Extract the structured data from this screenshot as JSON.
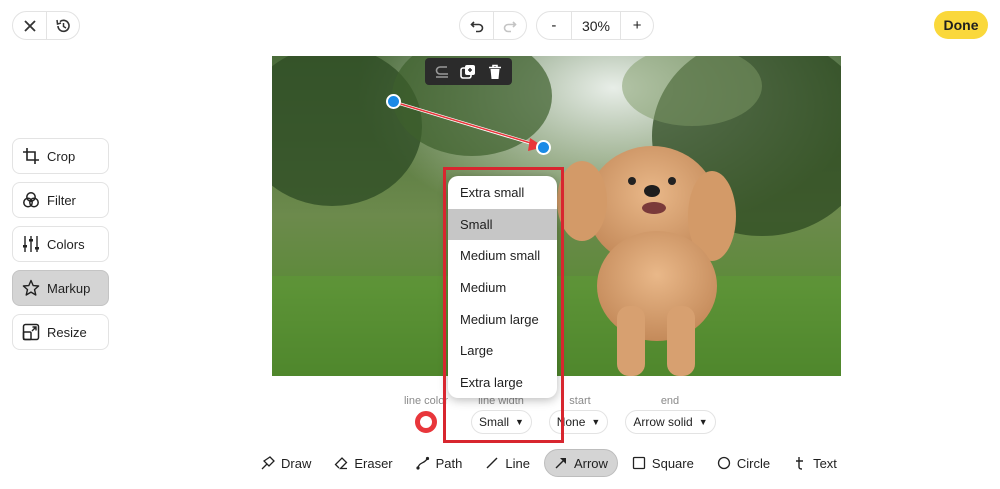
{
  "header": {
    "close_icon": "close-icon",
    "history_icon": "history-icon",
    "undo_icon": "undo-icon",
    "redo_icon": "redo-icon",
    "zoom_out_label": "-",
    "zoom_level": "30%",
    "zoom_in_label": "+",
    "done_label": "Done"
  },
  "sidebar": {
    "items": [
      {
        "label": "Crop",
        "icon": "crop-icon"
      },
      {
        "label": "Filter",
        "icon": "filter-icon"
      },
      {
        "label": "Colors",
        "icon": "sliders-icon"
      },
      {
        "label": "Markup",
        "icon": "star-icon",
        "active": true
      },
      {
        "label": "Resize",
        "icon": "resize-icon"
      }
    ]
  },
  "floating_toolbar": {
    "icons": [
      "reply-icon",
      "duplicate-icon",
      "trash-icon"
    ]
  },
  "options": {
    "line_color_label": "line color",
    "line_width_label": "line width",
    "line_width_value": "Small",
    "start_label": "start",
    "start_value": "None",
    "end_label": "end",
    "end_value": "Arrow solid",
    "line_color": "#e8363b"
  },
  "dropdown": {
    "items": [
      "Extra small",
      "Small",
      "Medium small",
      "Medium",
      "Medium large",
      "Large",
      "Extra large"
    ],
    "selected": "Small"
  },
  "markup_tools": [
    {
      "label": "Draw",
      "icon": "draw-icon"
    },
    {
      "label": "Eraser",
      "icon": "eraser-icon"
    },
    {
      "label": "Path",
      "icon": "path-icon"
    },
    {
      "label": "Line",
      "icon": "line-icon"
    },
    {
      "label": "Arrow",
      "icon": "arrow-icon",
      "active": true
    },
    {
      "label": "Square",
      "icon": "square-icon"
    },
    {
      "label": "Circle",
      "icon": "circle-icon"
    },
    {
      "label": "Text",
      "icon": "text-icon"
    }
  ],
  "colors": {
    "accent": "#fad83b",
    "handle": "#1a8ae6",
    "highlight": "#d8262f"
  }
}
